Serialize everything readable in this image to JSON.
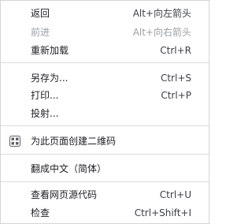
{
  "menu": {
    "back": {
      "label": "返回",
      "shortcut": "Alt+向左箭头"
    },
    "forward": {
      "label": "前进",
      "shortcut": "Alt+向右箭头",
      "disabled": true
    },
    "reload": {
      "label": "重新加载",
      "shortcut": "Ctrl+R"
    },
    "save_as": {
      "label": "另存为...",
      "shortcut": "Ctrl+S"
    },
    "print": {
      "label": "打印...",
      "shortcut": "Ctrl+P"
    },
    "cast": {
      "label": "投射..."
    },
    "qr": {
      "label": "为此页面创建二维码",
      "icon": "qr-code-icon"
    },
    "translate": {
      "label": "翻成中文（简体）"
    },
    "view_source": {
      "label": "查看网页源代码",
      "shortcut": "Ctrl+U"
    },
    "inspect": {
      "label": "检查",
      "shortcut": "Ctrl+Shift+I"
    }
  }
}
